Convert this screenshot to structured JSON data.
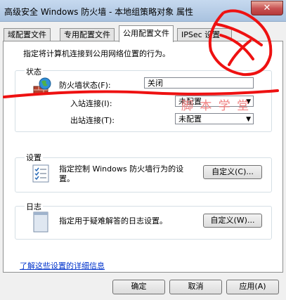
{
  "window": {
    "title": "高级安全 Windows 防火墙 - 本地组策略对象 属性",
    "close_glyph": "✕"
  },
  "tabs": [
    {
      "label": "域配置文件"
    },
    {
      "label": "专用配置文件"
    },
    {
      "label": "公用配置文件"
    },
    {
      "label": "IPSec 设置"
    }
  ],
  "description": "指定将计算机连接到公用网络位置的行为。",
  "state": {
    "group_label": "状态",
    "firewall_state_label": "防火墙状态(F):",
    "firewall_state_value": "关闭",
    "inbound_label": "入站连接(I):",
    "inbound_value": "未配置",
    "outbound_label": "出站连接(T):",
    "outbound_value": "未配置",
    "icon": "firewall-globe-icon"
  },
  "settings": {
    "group_label": "设置",
    "text": "指定控制 Windows 防火墙行为的设置。",
    "button_label": "自定义(C)...",
    "icon": "checklist-icon"
  },
  "logging": {
    "group_label": "日志",
    "text": "指定用于疑难解答的日志设置。",
    "button_label": "自定义(W)...",
    "icon": "notepad-icon"
  },
  "link_text": "了解这些设置的详细信息",
  "watermark": "脚 本 学 堂",
  "buttons": {
    "ok": "确定",
    "cancel": "取消",
    "apply": "应用(A)"
  },
  "colors": {
    "annotation_red": "#ee1111",
    "link": "#0033cc"
  }
}
